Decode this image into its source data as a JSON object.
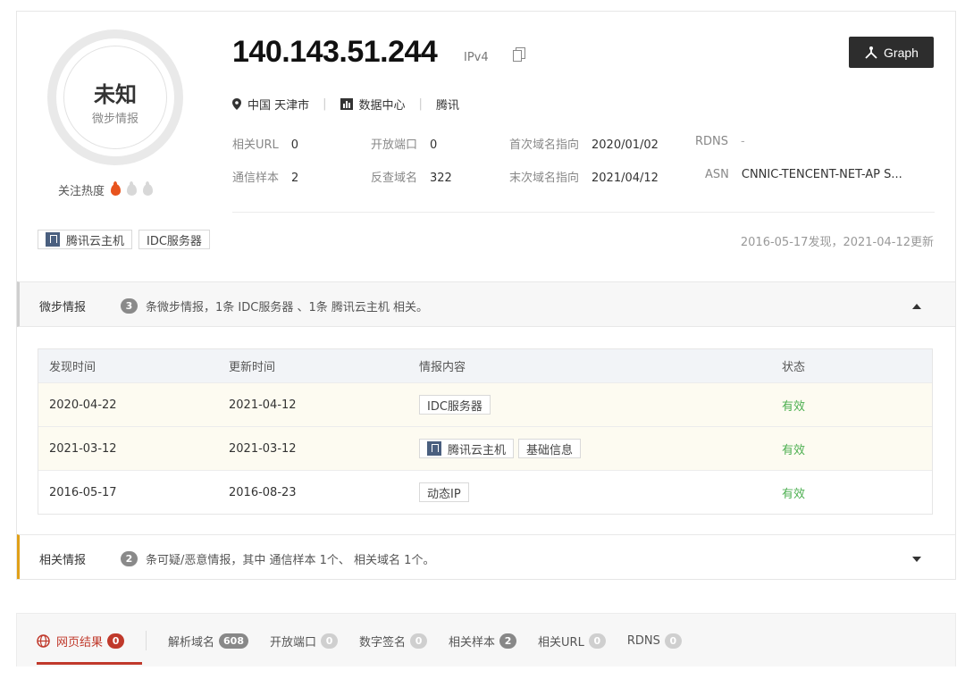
{
  "score": {
    "title": "未知",
    "subtitle": "微步情报",
    "heat_label": "关注热度",
    "heat_level": 1,
    "heat_max": 3
  },
  "ip": {
    "address": "140.143.51.244",
    "version": "IPv4"
  },
  "graph_button": {
    "label": "Graph"
  },
  "location": {
    "place": "中国 天津市",
    "type": "数据中心",
    "org": "腾讯"
  },
  "stats": {
    "related_url_label": "相关URL",
    "related_url": "0",
    "open_ports_label": "开放端口",
    "open_ports": "0",
    "first_resolve_label": "首次域名指向",
    "first_resolve": "2020/01/02",
    "rdns_label": "RDNS",
    "rdns": "-",
    "samples_label": "通信样本",
    "samples": "2",
    "reverse_label": "反查域名",
    "reverse": "322",
    "last_resolve_label": "末次域名指向",
    "last_resolve": "2021/04/12",
    "asn_label": "ASN",
    "asn": "CNNIC-TENCENT-NET-AP S..."
  },
  "tags": [
    "腾讯云主机",
    "IDC服务器"
  ],
  "found_text": "2016-05-17发现，2021-04-12更新",
  "intel": {
    "title": "微步情报",
    "count": "3",
    "desc": "条微步情报，1条 IDC服务器 、1条 腾讯云主机 相关。",
    "headers": [
      "发现时间",
      "更新时间",
      "情报内容",
      "状态"
    ],
    "rows": [
      {
        "found": "2020-04-22",
        "updated": "2021-04-12",
        "tags": [
          "IDC服务器"
        ],
        "status": "有效"
      },
      {
        "found": "2021-03-12",
        "updated": "2021-03-12",
        "tags": [
          "腾讯云主机",
          "基础信息"
        ],
        "status": "有效"
      },
      {
        "found": "2016-05-17",
        "updated": "2016-08-23",
        "tags": [
          "动态IP"
        ],
        "status": "有效"
      }
    ]
  },
  "related": {
    "title": "相关情报",
    "count": "2",
    "desc": "条可疑/恶意情报，其中 通信样本 1个、 相关域名 1个。"
  },
  "tabs": [
    {
      "label": "网页结果",
      "count": "0"
    },
    {
      "label": "解析域名",
      "count": "608"
    },
    {
      "label": "开放端口",
      "count": "0"
    },
    {
      "label": "数字签名",
      "count": "0"
    },
    {
      "label": "相关样本",
      "count": "2"
    },
    {
      "label": "相关URL",
      "count": "0"
    },
    {
      "label": "RDNS",
      "count": "0"
    }
  ],
  "colors": {
    "accent": "#c0392b",
    "valid": "#4caf50",
    "flame": "#e8541e",
    "warn_bar": "#e0a019"
  }
}
